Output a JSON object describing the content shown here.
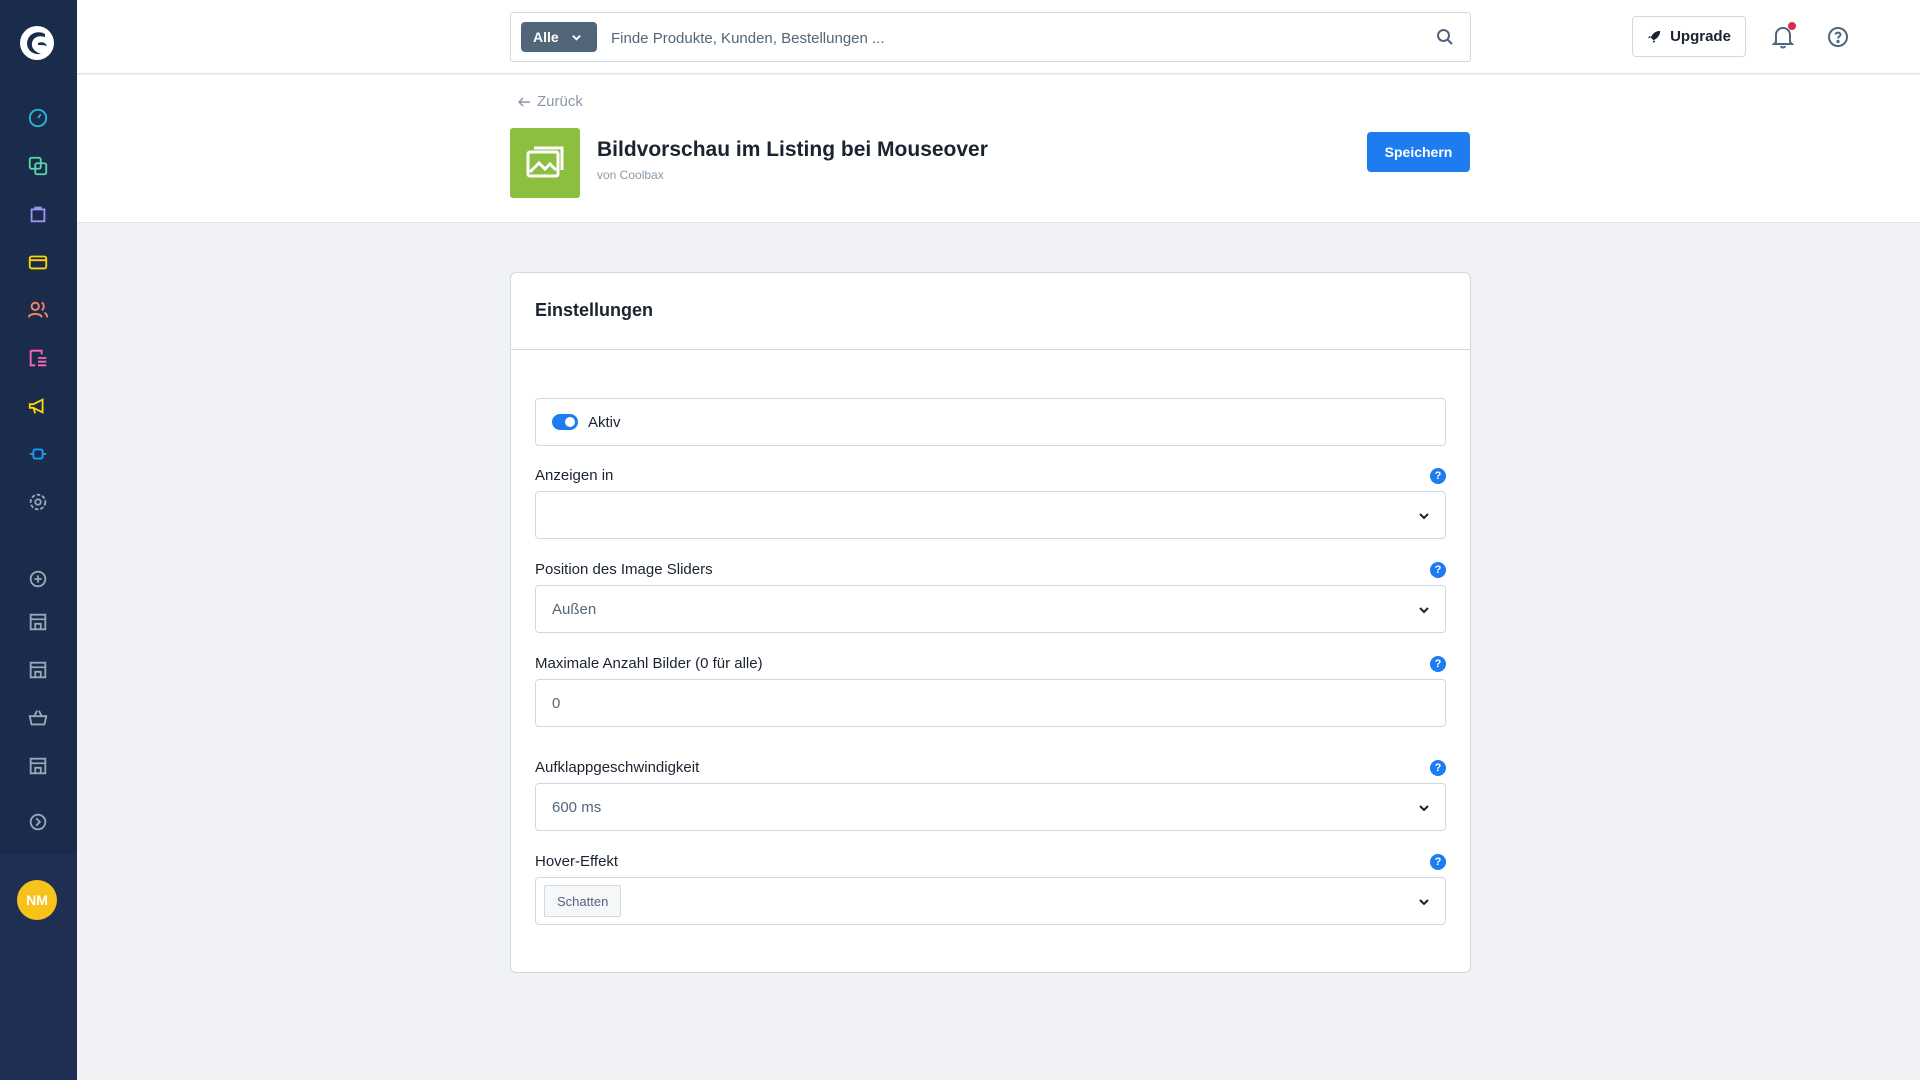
{
  "search": {
    "type_label": "Alle",
    "placeholder": "Finde Produkte, Kunden, Bestellungen ..."
  },
  "topbar": {
    "upgrade_label": "Upgrade"
  },
  "header": {
    "back_label": "Zurück",
    "plugin_title": "Bildvorschau im Listing bei Mouseover",
    "plugin_author": "von Coolbax",
    "save_label": "Speichern"
  },
  "user": {
    "initials": "NM"
  },
  "card": {
    "title": "Einstellungen",
    "active_label": "Aktiv",
    "active_value": true,
    "fields": [
      {
        "label": "Anzeigen in",
        "value": ""
      },
      {
        "label": "Position des Image Sliders",
        "value": "Außen"
      },
      {
        "label": "Maximale Anzahl Bilder (0 für alle)",
        "value": "0"
      },
      {
        "label": "Aufklappgeschwindigkeit",
        "value": "600 ms"
      },
      {
        "label": "Hover-Effekt",
        "value": "Schatten"
      }
    ],
    "help_glyph": "?"
  },
  "sidebar": {
    "icons": [
      "dashboard-icon",
      "catalog-icon",
      "orders-icon",
      "payment-icon",
      "customers-icon",
      "content-icon",
      "marketing-icon",
      "extensions-icon",
      "settings-icon",
      "add-channel-icon",
      "storefront-icon",
      "storefront-icon",
      "basket-icon",
      "storefront-icon",
      "expand-icon"
    ]
  },
  "colors": {
    "sidebar": "#1b2b4b",
    "accent": "#1c7cf0",
    "plugin_icon_bg": "#8cbf3f",
    "avatar": "#f7c31b",
    "notification_dot": "#de294c"
  }
}
